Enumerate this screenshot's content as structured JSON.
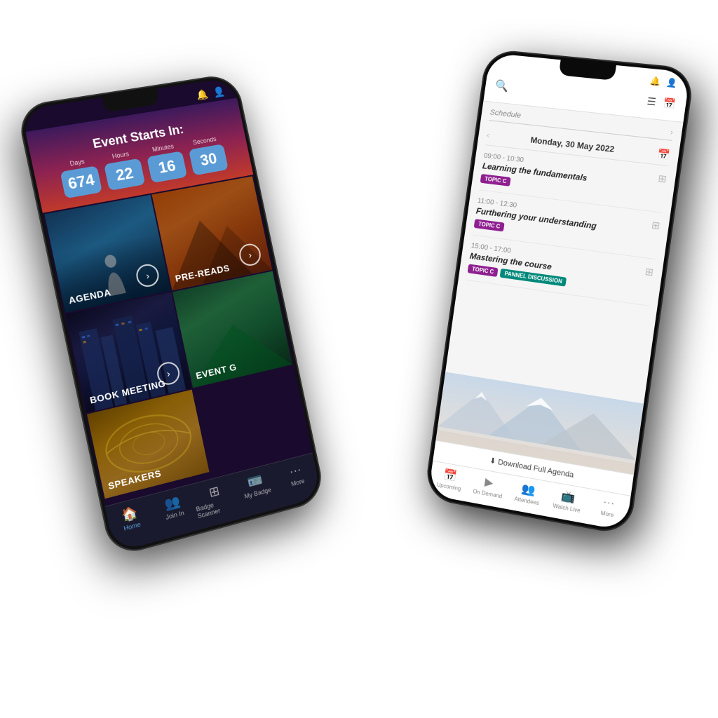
{
  "page": {
    "background": "#ffffff"
  },
  "left_phone": {
    "countdown": {
      "title": "Event Starts In:",
      "labels": [
        "Days",
        "Hours",
        "Minutes",
        "Seconds"
      ],
      "values": [
        "674",
        "22",
        "16",
        "30"
      ]
    },
    "tiles": [
      {
        "id": "agenda",
        "label": "AGENDA",
        "has_arrow": true
      },
      {
        "id": "prereads",
        "label": "PRE-READS",
        "has_arrow": true
      },
      {
        "id": "meeting",
        "label": "BOOK MEETING",
        "has_arrow": true
      },
      {
        "id": "event",
        "label": "EVENT G",
        "has_arrow": false
      },
      {
        "id": "speakers",
        "label": "SPEAKERS",
        "has_arrow": false
      }
    ],
    "nav": [
      {
        "label": "Home",
        "icon": "🏠",
        "active": true
      },
      {
        "label": "Join In",
        "icon": "👥",
        "active": false
      },
      {
        "label": "Badge Scanner",
        "icon": "⊞",
        "active": false
      },
      {
        "label": "My Badge",
        "icon": "🪪",
        "active": false
      },
      {
        "label": "More",
        "icon": "···",
        "active": false
      }
    ]
  },
  "right_phone": {
    "header": {
      "icons": [
        "search",
        "list",
        "calendar",
        "bell",
        "person"
      ]
    },
    "schedule": {
      "title": "Schedule",
      "date": "Monday, 30 May 2022",
      "sessions": [
        {
          "time": "09:00 - 10:30",
          "title": "Learning the fundamentals",
          "tags": [
            "TOPIC C"
          ]
        },
        {
          "time": "11:00 - 12:30",
          "title": "Furthering your understanding",
          "tags": [
            "TOPIC C"
          ]
        },
        {
          "time": "15:00 - 17:00",
          "title": "Mastering the course",
          "tags": [
            "TOPIC C",
            "PANNEL DISCUSSION"
          ]
        }
      ]
    },
    "download_label": "⬇ Download Full Agenda",
    "nav": [
      {
        "label": "Upcoming",
        "icon": "📅",
        "active": false
      },
      {
        "label": "On Demand",
        "icon": "▶",
        "active": false
      },
      {
        "label": "Attendees",
        "icon": "👥",
        "active": false
      },
      {
        "label": "Watch Live",
        "icon": "📺",
        "active": false
      },
      {
        "label": "More",
        "icon": "···",
        "active": false
      }
    ]
  }
}
